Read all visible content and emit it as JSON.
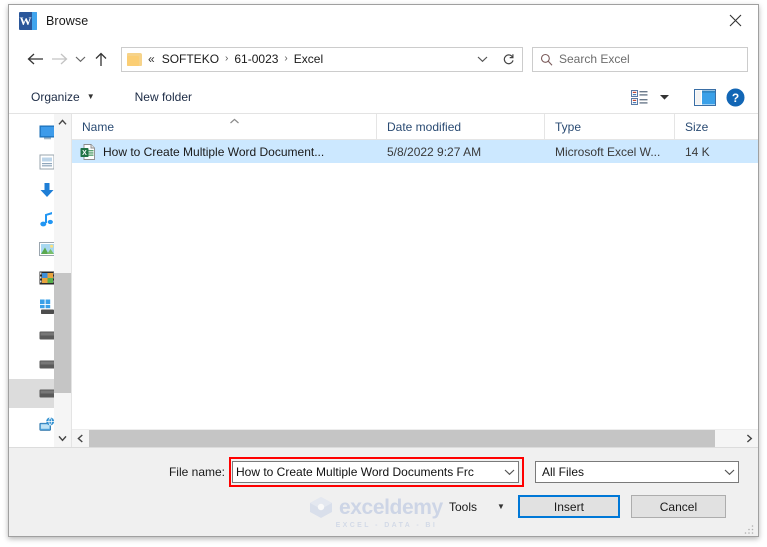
{
  "window": {
    "title": "Browse",
    "app_icon": "word-icon",
    "close_label": "×"
  },
  "nav": {
    "back_icon": "arrow-left-icon",
    "forward_icon": "arrow-right-icon",
    "history_icon": "chevron-down-icon",
    "up_icon": "arrow-up-icon",
    "refresh_icon": "refresh-icon",
    "address_dropdown_icon": "chevron-down-icon",
    "folder_icon": "folder-icon",
    "breadcrumb_lead": "«",
    "breadcrumb": [
      "SOFTEKO",
      "61-0023",
      "Excel"
    ],
    "separator": "›"
  },
  "search": {
    "placeholder": "Search Excel",
    "icon": "search-icon"
  },
  "toolbar": {
    "organize_label": "Organize",
    "organize_caret": "▼",
    "new_folder_label": "New folder",
    "view_icon": "view-list-icon",
    "view_caret": "▼",
    "preview_pane_icon": "preview-pane-icon",
    "help_icon": "help-icon",
    "help_glyph": "?"
  },
  "sidebar": {
    "items": [
      {
        "name": "desktop",
        "icon": "desktop-icon",
        "selected": false
      },
      {
        "name": "documents",
        "icon": "documents-icon",
        "selected": false
      },
      {
        "name": "downloads",
        "icon": "downloads-icon",
        "selected": false
      },
      {
        "name": "music",
        "icon": "music-icon",
        "selected": false
      },
      {
        "name": "pictures",
        "icon": "pictures-icon",
        "selected": false
      },
      {
        "name": "videos",
        "icon": "videos-icon",
        "selected": false
      },
      {
        "name": "windows-drive",
        "icon": "windows-drive-icon",
        "selected": false
      },
      {
        "name": "local-disk-1",
        "icon": "drive-icon",
        "selected": false
      },
      {
        "name": "local-disk-2",
        "icon": "drive-icon",
        "selected": false
      },
      {
        "name": "local-disk-3",
        "icon": "drive-icon",
        "selected": true
      },
      {
        "name": "network",
        "icon": "network-icon",
        "selected": false
      }
    ],
    "scroll_up_icon": "chevron-up-icon",
    "scroll_down_icon": "chevron-down-icon"
  },
  "file_list": {
    "columns": [
      {
        "label": "Name",
        "sorted": true,
        "sort_icon": "sort-ascending-icon"
      },
      {
        "label": "Date modified",
        "sorted": false
      },
      {
        "label": "Type",
        "sorted": false
      },
      {
        "label": "Size",
        "sorted": false
      }
    ],
    "rows": [
      {
        "icon": "excel-file-icon",
        "name": "How to Create Multiple Word Document...",
        "date_modified": "5/8/2022 9:27 AM",
        "type": "Microsoft Excel W...",
        "size": "14 K",
        "selected": true
      }
    ],
    "hscroll_left_icon": "chevron-left-icon",
    "hscroll_right_icon": "chevron-right-icon"
  },
  "footer": {
    "file_name_label": "File name:",
    "file_name_value": "How to Create Multiple Word Documents Frc",
    "file_name_caret": "chevron-down-icon",
    "file_type_value": "All Files",
    "file_type_caret": "chevron-down-icon",
    "tools_label": "Tools",
    "tools_caret": "▼",
    "insert_label": "Insert",
    "cancel_label": "Cancel",
    "highlight_color": "#ff0000",
    "default_button_color": "#0078d7"
  },
  "watermark": {
    "text": "exceldemy",
    "tagline": "EXCEL - DATA - BI"
  }
}
